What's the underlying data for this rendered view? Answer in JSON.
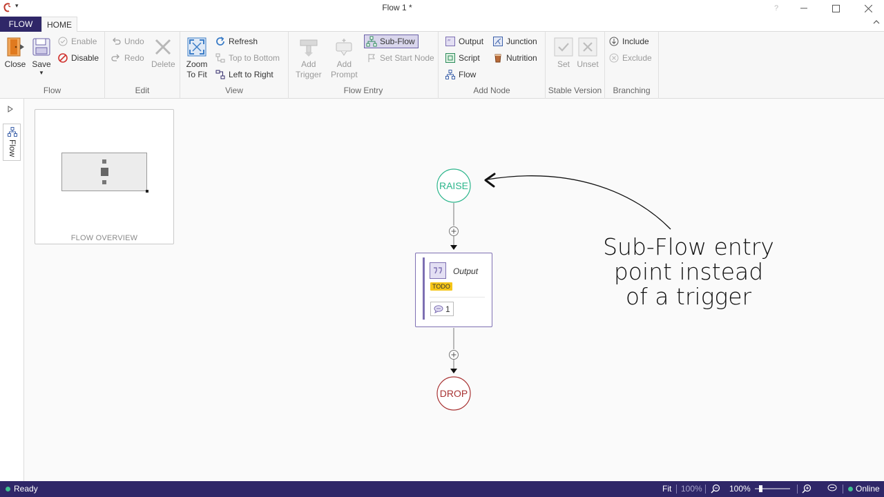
{
  "window": {
    "title": "Flow 1 *",
    "help": "?"
  },
  "tabs": {
    "flow": "FLOW",
    "home": "HOME"
  },
  "ribbon": {
    "groups": {
      "flow": {
        "label": "Flow",
        "close": "Close",
        "save": "Save",
        "enable": "Enable",
        "disable": "Disable"
      },
      "edit": {
        "label": "Edit",
        "undo": "Undo",
        "redo": "Redo",
        "delete": "Delete"
      },
      "view": {
        "label": "View",
        "zoom_line1": "Zoom",
        "zoom_line2": "To Fit",
        "refresh": "Refresh",
        "top_to_bottom": "Top to Bottom",
        "left_to_right": "Left to Right"
      },
      "flow_entry": {
        "label": "Flow Entry",
        "add_trigger_1": "Add",
        "add_trigger_2": "Trigger",
        "add_prompt_1": "Add",
        "add_prompt_2": "Prompt",
        "sub_flow": "Sub-Flow",
        "set_start_node": "Set Start Node"
      },
      "add_node": {
        "label": "Add Node",
        "output": "Output",
        "script": "Script",
        "flow": "Flow",
        "junction": "Junction",
        "nutrition": "Nutrition"
      },
      "stable_version": {
        "label": "Stable Version",
        "set": "Set",
        "unset": "Unset"
      },
      "branching": {
        "label": "Branching",
        "include": "Include",
        "exclude": "Exclude"
      }
    }
  },
  "side_panel": {
    "tab_label": "Flow"
  },
  "overview": {
    "label": "FLOW OVERVIEW"
  },
  "diagram": {
    "start_node": "RAISE",
    "end_node": "DROP",
    "output_node": {
      "title": "Output",
      "badge": "TODO",
      "comment_count": "1"
    }
  },
  "annotation": {
    "line1": "Sub-Flow entry",
    "line2": "point instead",
    "line3": "of a trigger"
  },
  "status": {
    "ready": "Ready",
    "fit": "Fit",
    "zoom_preset": "100%",
    "zoom_current": "100%",
    "connection": "Online"
  },
  "colors": {
    "brand": "#2f2768",
    "start_node": "#2bb58b",
    "end_node": "#a83232",
    "todo_badge": "#f5c518",
    "output_accent": "#7d6fb2"
  }
}
